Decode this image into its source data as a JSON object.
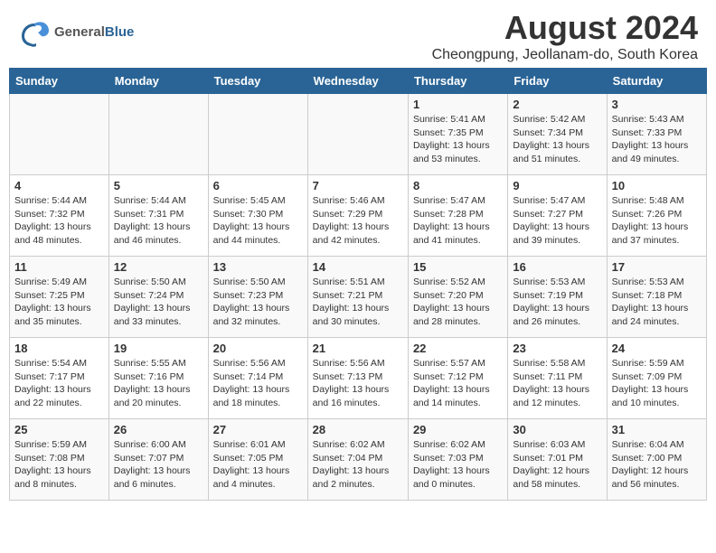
{
  "header": {
    "logo_general": "General",
    "logo_blue": "Blue",
    "main_title": "August 2024",
    "subtitle": "Cheongpung, Jeollanam-do, South Korea"
  },
  "weekdays": [
    "Sunday",
    "Monday",
    "Tuesday",
    "Wednesday",
    "Thursday",
    "Friday",
    "Saturday"
  ],
  "weeks": [
    {
      "days": [
        {
          "num": "",
          "info": ""
        },
        {
          "num": "",
          "info": ""
        },
        {
          "num": "",
          "info": ""
        },
        {
          "num": "",
          "info": ""
        },
        {
          "num": "1",
          "info": "Sunrise: 5:41 AM\nSunset: 7:35 PM\nDaylight: 13 hours\nand 53 minutes."
        },
        {
          "num": "2",
          "info": "Sunrise: 5:42 AM\nSunset: 7:34 PM\nDaylight: 13 hours\nand 51 minutes."
        },
        {
          "num": "3",
          "info": "Sunrise: 5:43 AM\nSunset: 7:33 PM\nDaylight: 13 hours\nand 49 minutes."
        }
      ]
    },
    {
      "days": [
        {
          "num": "4",
          "info": "Sunrise: 5:44 AM\nSunset: 7:32 PM\nDaylight: 13 hours\nand 48 minutes."
        },
        {
          "num": "5",
          "info": "Sunrise: 5:44 AM\nSunset: 7:31 PM\nDaylight: 13 hours\nand 46 minutes."
        },
        {
          "num": "6",
          "info": "Sunrise: 5:45 AM\nSunset: 7:30 PM\nDaylight: 13 hours\nand 44 minutes."
        },
        {
          "num": "7",
          "info": "Sunrise: 5:46 AM\nSunset: 7:29 PM\nDaylight: 13 hours\nand 42 minutes."
        },
        {
          "num": "8",
          "info": "Sunrise: 5:47 AM\nSunset: 7:28 PM\nDaylight: 13 hours\nand 41 minutes."
        },
        {
          "num": "9",
          "info": "Sunrise: 5:47 AM\nSunset: 7:27 PM\nDaylight: 13 hours\nand 39 minutes."
        },
        {
          "num": "10",
          "info": "Sunrise: 5:48 AM\nSunset: 7:26 PM\nDaylight: 13 hours\nand 37 minutes."
        }
      ]
    },
    {
      "days": [
        {
          "num": "11",
          "info": "Sunrise: 5:49 AM\nSunset: 7:25 PM\nDaylight: 13 hours\nand 35 minutes."
        },
        {
          "num": "12",
          "info": "Sunrise: 5:50 AM\nSunset: 7:24 PM\nDaylight: 13 hours\nand 33 minutes."
        },
        {
          "num": "13",
          "info": "Sunrise: 5:50 AM\nSunset: 7:23 PM\nDaylight: 13 hours\nand 32 minutes."
        },
        {
          "num": "14",
          "info": "Sunrise: 5:51 AM\nSunset: 7:21 PM\nDaylight: 13 hours\nand 30 minutes."
        },
        {
          "num": "15",
          "info": "Sunrise: 5:52 AM\nSunset: 7:20 PM\nDaylight: 13 hours\nand 28 minutes."
        },
        {
          "num": "16",
          "info": "Sunrise: 5:53 AM\nSunset: 7:19 PM\nDaylight: 13 hours\nand 26 minutes."
        },
        {
          "num": "17",
          "info": "Sunrise: 5:53 AM\nSunset: 7:18 PM\nDaylight: 13 hours\nand 24 minutes."
        }
      ]
    },
    {
      "days": [
        {
          "num": "18",
          "info": "Sunrise: 5:54 AM\nSunset: 7:17 PM\nDaylight: 13 hours\nand 22 minutes."
        },
        {
          "num": "19",
          "info": "Sunrise: 5:55 AM\nSunset: 7:16 PM\nDaylight: 13 hours\nand 20 minutes."
        },
        {
          "num": "20",
          "info": "Sunrise: 5:56 AM\nSunset: 7:14 PM\nDaylight: 13 hours\nand 18 minutes."
        },
        {
          "num": "21",
          "info": "Sunrise: 5:56 AM\nSunset: 7:13 PM\nDaylight: 13 hours\nand 16 minutes."
        },
        {
          "num": "22",
          "info": "Sunrise: 5:57 AM\nSunset: 7:12 PM\nDaylight: 13 hours\nand 14 minutes."
        },
        {
          "num": "23",
          "info": "Sunrise: 5:58 AM\nSunset: 7:11 PM\nDaylight: 13 hours\nand 12 minutes."
        },
        {
          "num": "24",
          "info": "Sunrise: 5:59 AM\nSunset: 7:09 PM\nDaylight: 13 hours\nand 10 minutes."
        }
      ]
    },
    {
      "days": [
        {
          "num": "25",
          "info": "Sunrise: 5:59 AM\nSunset: 7:08 PM\nDaylight: 13 hours\nand 8 minutes."
        },
        {
          "num": "26",
          "info": "Sunrise: 6:00 AM\nSunset: 7:07 PM\nDaylight: 13 hours\nand 6 minutes."
        },
        {
          "num": "27",
          "info": "Sunrise: 6:01 AM\nSunset: 7:05 PM\nDaylight: 13 hours\nand 4 minutes."
        },
        {
          "num": "28",
          "info": "Sunrise: 6:02 AM\nSunset: 7:04 PM\nDaylight: 13 hours\nand 2 minutes."
        },
        {
          "num": "29",
          "info": "Sunrise: 6:02 AM\nSunset: 7:03 PM\nDaylight: 13 hours\nand 0 minutes."
        },
        {
          "num": "30",
          "info": "Sunrise: 6:03 AM\nSunset: 7:01 PM\nDaylight: 12 hours\nand 58 minutes."
        },
        {
          "num": "31",
          "info": "Sunrise: 6:04 AM\nSunset: 7:00 PM\nDaylight: 12 hours\nand 56 minutes."
        }
      ]
    }
  ]
}
